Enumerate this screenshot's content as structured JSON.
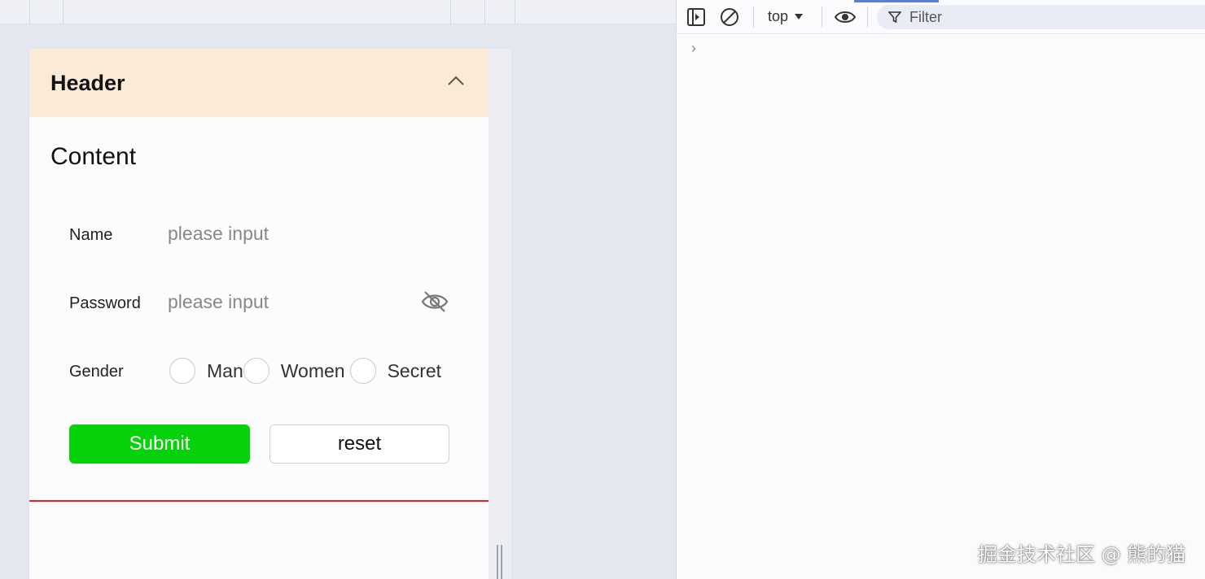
{
  "panel": {
    "header_title": "Header",
    "content_title": "Content"
  },
  "form": {
    "name_label": "Name",
    "name_placeholder": "please input",
    "password_label": "Password",
    "password_placeholder": "please input",
    "gender_label": "Gender",
    "gender_options": [
      "Man",
      "Women",
      "Secret"
    ],
    "submit_label": "Submit",
    "reset_label": "reset"
  },
  "devtools": {
    "context": "top",
    "filter_placeholder": "Filter",
    "prompt": "›"
  },
  "watermark": "掘金技术社区 @ 熊的猫",
  "colors": {
    "header_bg": "#fbebd6",
    "submit_bg": "#05d20a",
    "divider": "#ee2222"
  }
}
